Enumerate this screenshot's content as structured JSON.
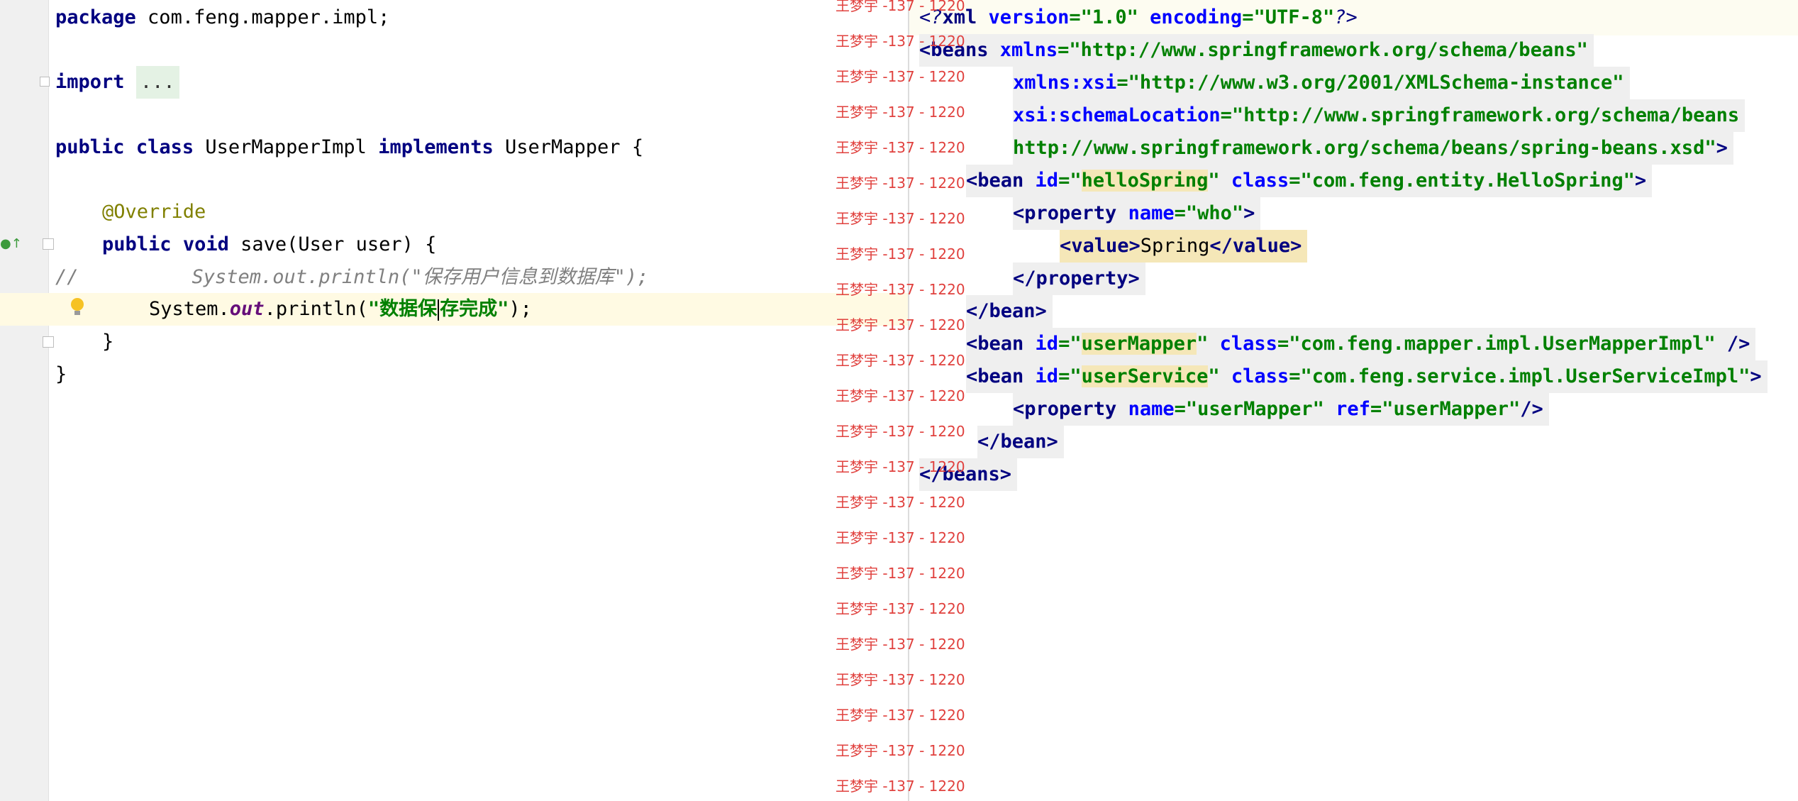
{
  "java": {
    "line_package": "package",
    "line_package_rest": " com.feng.mapper.impl;",
    "line_import_kw": "import",
    "line_import_fold": "...",
    "kw_public": "public",
    "kw_class": "class",
    "class_name": " UserMapperImpl ",
    "kw_implements": "implements",
    "iface": " UserMapper {",
    "annotation": "@Override",
    "kw_public2": "public",
    "kw_void": "void",
    "method_sig": " save(User user) {",
    "comment_prefix": "//",
    "comment_text": "System.out.println(\"保存用户信息到数据库\");",
    "println_prefix": "System.",
    "field_out": "out",
    "println_call": ".println(",
    "str_part1": "\"数据保",
    "str_part2": "存完成\"",
    "println_end": ");",
    "close_method": "}",
    "close_class": "}"
  },
  "xml": {
    "l1": [
      "<?",
      "xml",
      " version",
      "=",
      "\"1.0\"",
      " encoding",
      "=",
      "\"UTF-8\"",
      "?>"
    ],
    "l2_tag": "<beans",
    "l2_attr": " xmlns",
    "l2_val": "=\"http://www.springframework.org/schema/beans\"",
    "l3_attr": "xmlns:xsi",
    "l3_val": "=\"http://www.w3.org/2001/XMLSchema-instance\"",
    "l4_attr": "xsi:schemaLocation",
    "l4_val": "=\"http://www.springframework.org/schema/beans",
    "l5_val": "http://www.springframework.org/schema/beans/spring-beans.xsd\"",
    "l5_end": ">",
    "l6_tag": "<bean",
    "l6_attr1": " id",
    "l6_eq1": "=\"",
    "l6_id": "helloSpring",
    "l6_q1": "\"",
    "l6_attr2": " class",
    "l6_val2": "=\"com.feng.entity.HelloSpring\"",
    "l6_end": ">",
    "l7_tag": "<property",
    "l7_attr": " name",
    "l7_val": "=\"who\"",
    "l7_end": ">",
    "l8_open": "<value>",
    "l8_text": "Spring",
    "l8_close": "</value>",
    "l9": "</property>",
    "l10": "</bean>",
    "l11_tag": "<bean",
    "l11_attr1": " id",
    "l11_eq1": "=\"",
    "l11_id": "userMapper",
    "l11_q1": "\"",
    "l11_attr2": " class",
    "l11_val2": "=\"com.feng.mapper.impl.UserMapperImpl\"",
    "l11_end": " />",
    "l12_tag": "<bean",
    "l12_attr1": " id",
    "l12_eq1": "=\"",
    "l12_id": "userService",
    "l12_q1": "\"",
    "l12_attr2": " class",
    "l12_val2": "=\"com.feng.service.impl.UserServiceImpl\"",
    "l12_end": ">",
    "l13_tag": "<property",
    "l13_attr1": " name",
    "l13_val1": "=\"userMapper\"",
    "l13_attr2": " ref",
    "l13_val2": "=\"userMapper\"",
    "l13_end": "/>",
    "l14": "</bean>",
    "l15": "</beans>"
  },
  "watermark": {
    "text": "王梦宇 -137 - 1220",
    "repeat_count": 23
  }
}
